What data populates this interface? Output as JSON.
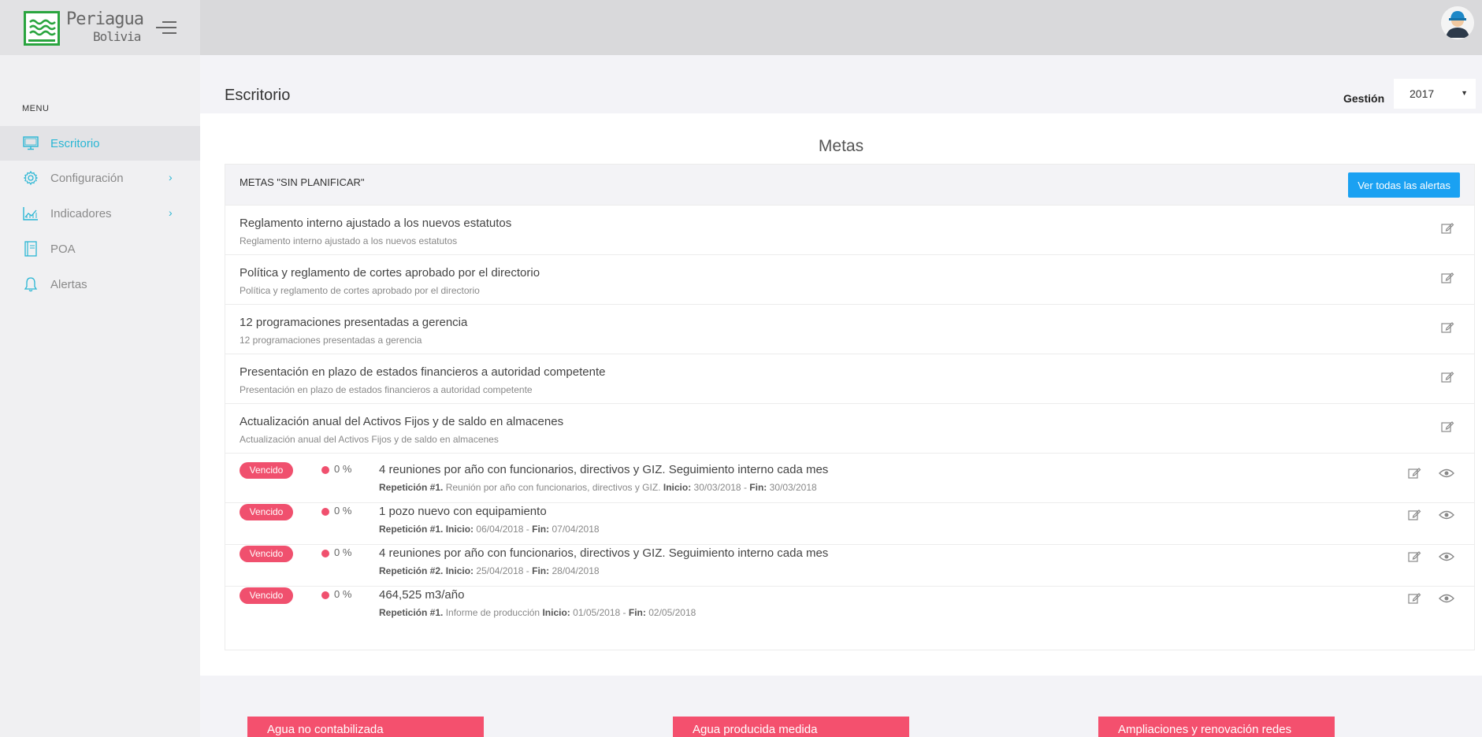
{
  "brand": {
    "name": "Periagua",
    "country": "Bolivia",
    "icon": "periagua-logo"
  },
  "sidebar": {
    "menu_title": "MENU",
    "items": [
      {
        "label": "Escritorio",
        "icon": "monitor-icon",
        "active": true
      },
      {
        "label": "Configuración",
        "icon": "gear-icon",
        "has_children": true
      },
      {
        "label": "Indicadores",
        "icon": "chart-icon",
        "has_children": true
      },
      {
        "label": "POA",
        "icon": "book-icon"
      },
      {
        "label": "Alertas",
        "icon": "bell-icon"
      }
    ],
    "chevron": "›"
  },
  "header": {
    "title": "Escritorio",
    "gestion_label": "Gestión",
    "gestion_value": "2017",
    "caret": "▼"
  },
  "panel": {
    "title": "Metas",
    "box_title": "METAS \"SIN PLANIFICAR\"",
    "alerts_button": "Ver todas las alertas",
    "unplanned": [
      {
        "title": "Reglamento interno ajustado a los nuevos estatutos",
        "subtitle": "Reglamento interno ajustado a los nuevos estatutos"
      },
      {
        "title": "Política y reglamento de cortes aprobado por el directorio",
        "subtitle": "Política y reglamento de cortes aprobado por el directorio"
      },
      {
        "title": "12 programaciones presentadas a gerencia",
        "subtitle": "12 programaciones presentadas a gerencia"
      },
      {
        "title": "Presentación en plazo de estados financieros a autoridad competente",
        "subtitle": "Presentación en plazo de estados financieros a autoridad competente"
      },
      {
        "title": "Actualización anual del Activos Fijos y de saldo en almacenes",
        "subtitle": "Actualización anual del Activos Fijos y de saldo en almacenes"
      }
    ],
    "expired": [
      {
        "badge": "Vencido",
        "percent": "0 %",
        "title": "4 reuniones por año con funcionarios, directivos y GIZ. Seguimiento interno cada mes",
        "rep_label": "Repetición #1.",
        "rep_text": "Reunión por año con funcionarios, directivos y GIZ.",
        "start_label": "Inicio:",
        "start": "30/03/2018",
        "sep": "-",
        "end_label": "Fin:",
        "end": "30/03/2018"
      },
      {
        "badge": "Vencido",
        "percent": "0 %",
        "title": "1 pozo nuevo con equipamiento",
        "rep_label": "Repetición #1.",
        "rep_text": "",
        "start_label": "Inicio:",
        "start": "06/04/2018",
        "sep": "-",
        "end_label": "Fin:",
        "end": "07/04/2018"
      },
      {
        "badge": "Vencido",
        "percent": "0 %",
        "title": "4 reuniones por año con funcionarios, directivos y GIZ. Seguimiento interno cada mes",
        "rep_label": "Repetición #2.",
        "rep_text": "",
        "start_label": "Inicio:",
        "start": "25/04/2018",
        "sep": "-",
        "end_label": "Fin:",
        "end": "28/04/2018"
      },
      {
        "badge": "Vencido",
        "percent": "0 %",
        "title": "464,525 m3/año",
        "rep_label": "Repetición #1.",
        "rep_text": "Informe de producción",
        "start_label": "Inicio:",
        "start": "01/05/2018",
        "sep": "-",
        "end_label": "Fin:",
        "end": "02/05/2018"
      }
    ]
  },
  "cards": [
    {
      "label": "Agua no contabilizada"
    },
    {
      "label": "Agua producida medida"
    },
    {
      "label": "Ampliaciones y renovación redes"
    }
  ],
  "colors": {
    "accent": "#29b6d4",
    "danger": "#f0506e",
    "button": "#1aa1f2",
    "logo": "#2aa53f"
  }
}
